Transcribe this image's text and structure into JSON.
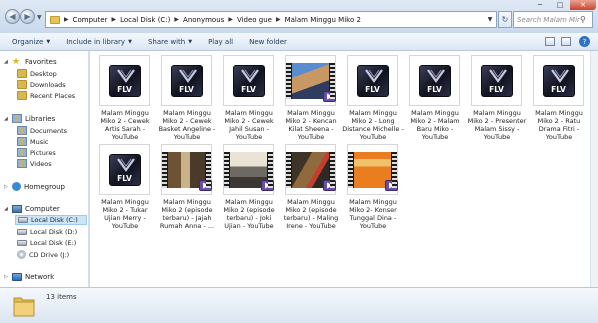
{
  "address_bar": {
    "breadcrumbs": [
      "Computer",
      "Local Disk (C:)",
      "Anonymous",
      "Video gue",
      "Malam Minggu Miko 2"
    ]
  },
  "search": {
    "placeholder": "Search Malam Minggu..."
  },
  "toolbar": {
    "organize": "Organize",
    "include_in_library": "Include in library",
    "share_with": "Share with",
    "play_all": "Play all",
    "new_folder": "New folder"
  },
  "nav": {
    "favorites": "Favorites",
    "desktop": "Desktop",
    "downloads": "Downloads",
    "recent_places": "Recent Places",
    "libraries": "Libraries",
    "documents": "Documents",
    "music": "Music",
    "pictures": "Pictures",
    "videos": "Videos",
    "homegroup": "Homegroup",
    "computer": "Computer",
    "local_disk_c": "Local Disk (C:)",
    "local_disk_d": "Local Disk (D:)",
    "local_disk_e": "Local Disk (E:)",
    "cd_drive": "CD Drive (J:)",
    "network": "Network"
  },
  "files": [
    {
      "label": "Malam Minggu Miko 2 - Cewek Artis Sarah - YouTube",
      "thumb": "flv-icon"
    },
    {
      "label": "Malam Minggu Miko 2 - Cewek Basket Angeline - YouTube",
      "thumb": "flv-icon"
    },
    {
      "label": "Malam Minggu Miko 2 - Cewek Jahil Susan - YouTube",
      "thumb": "flv-icon"
    },
    {
      "label": "Malam Minggu Miko 2 - Kencan Kilat Sheena - YouTube",
      "thumb": "video-frame"
    },
    {
      "label": "Malam Minggu Miko 2 - Long Distance Michelle - YouTube",
      "thumb": "flv-icon"
    },
    {
      "label": "Malam Minggu Miko 2 - Malam Baru Miko - YouTube",
      "thumb": "flv-icon"
    },
    {
      "label": "Malam Minggu Miko 2 - Presenter Malam Sissy - YouTube",
      "thumb": "flv-icon"
    },
    {
      "label": "Malam Minggu Miko 2 - Ratu Drama Fitri - YouTube",
      "thumb": "flv-icon"
    },
    {
      "label": "Malam Minggu Miko 2 - Tukar Ujian Merry - YouTube",
      "thumb": "flv-icon"
    },
    {
      "label": "Malam Minggu Miko 2 (episode terbaru) - Jajah Rumah Anna - ...",
      "thumb": "video-frame"
    },
    {
      "label": "Malam Minggu Miko 2 (episode terbaru) - Joki Ujian - YouTube",
      "thumb": "video-frame"
    },
    {
      "label": "Malam Minggu Miko 2 (episode terbaru) - Maling Irene - YouTube",
      "thumb": "video-frame"
    },
    {
      "label": "Malam Minggu Miko 2- Konser Tunggal Dina - YouTube",
      "thumb": "video-frame"
    }
  ],
  "flv_text": "FLV",
  "status": {
    "item_count": "13 items"
  },
  "colors": {
    "accent": "#1e395b",
    "selection": "#cce4f7",
    "flv_badge": "#2b2f47"
  }
}
